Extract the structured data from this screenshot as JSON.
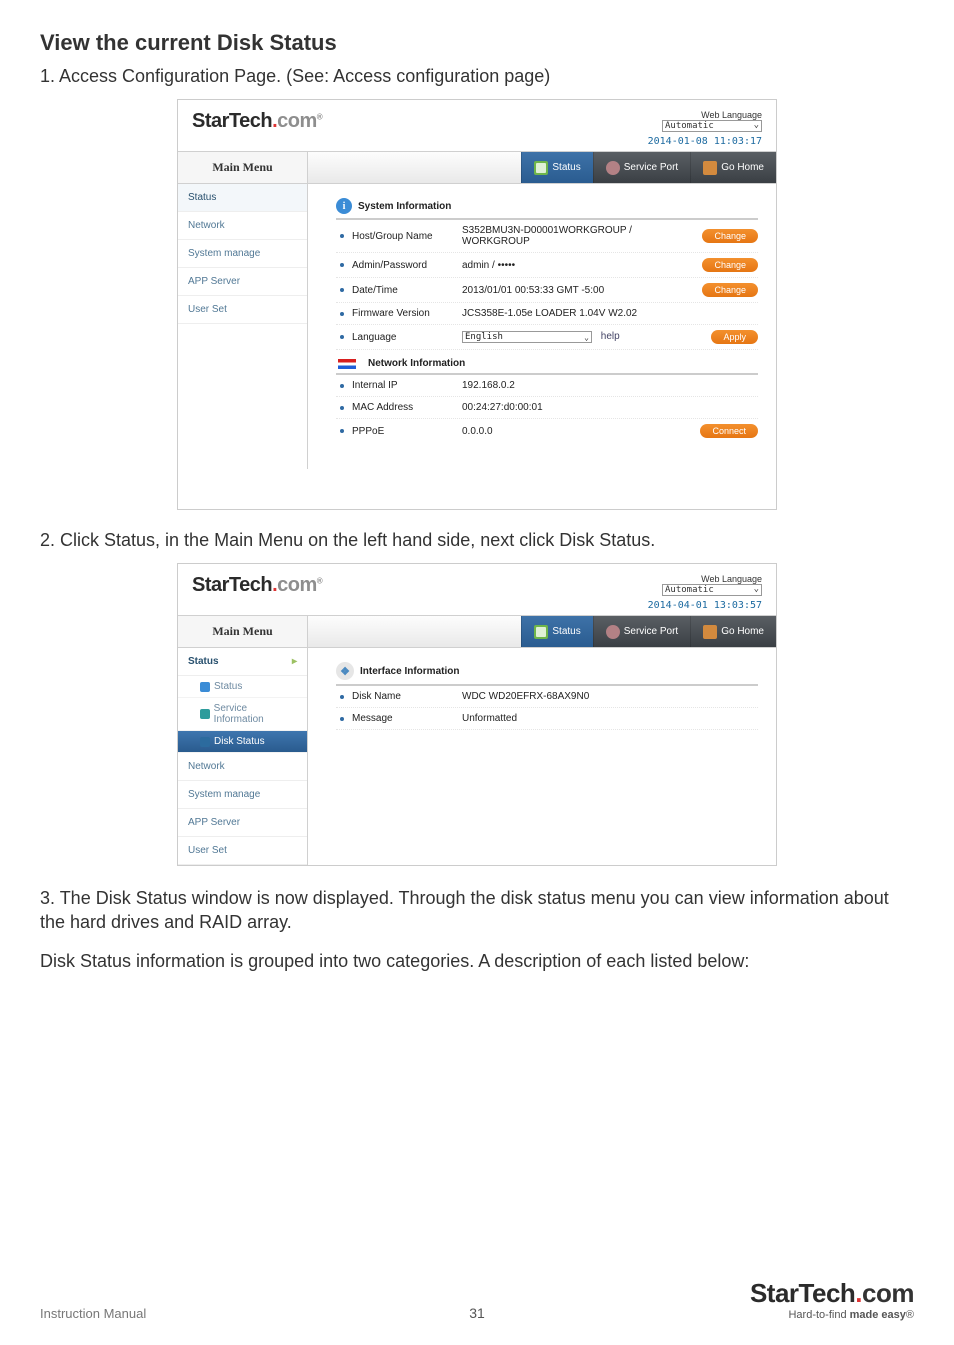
{
  "page": {
    "heading": "View the current Disk Status",
    "step1": "1.  Access Configuration Page. (See: Access configuration page)",
    "step2": "2.  Click Status, in the Main Menu on the left hand side, next click Disk Status.",
    "step3": "3.  The Disk Status window is now displayed. Through the disk status menu you can view information about the hard drives and RAID array.",
    "para": "Disk Status information is grouped into two categories. A description of each listed below:",
    "footer_im": "Instruction Manual",
    "footer_pg": "31",
    "brand_st": "StarTech",
    "brand_com": "com",
    "tagline_a": "Hard-to-find ",
    "tagline_b": "made easy"
  },
  "sc1": {
    "web_language_label": "Web Language",
    "web_language_value": "Automatic",
    "timestamp": "2014-01-08 11:03:17",
    "main_menu": "Main Menu",
    "tabs": {
      "status": "Status",
      "service_port": "Service Port",
      "go_home": "Go Home"
    },
    "sidebar": [
      "Status",
      "Network",
      "System manage",
      "APP Server",
      "User Set"
    ],
    "system_info_title": "System Information",
    "rows": {
      "host_label": "Host/Group Name",
      "host_value": "S352BMU3N-D00001WORKGROUP / WORKGROUP",
      "admin_label": "Admin/Password",
      "admin_value": "admin / •••••",
      "date_label": "Date/Time",
      "date_value": "2013/01/01 00:53:33 GMT -5:00",
      "fw_label": "Firmware Version",
      "fw_value": "JCS358E-1.05e LOADER 1.04V W2.02",
      "lang_label": "Language",
      "lang_value": "English",
      "lang_help": "help"
    },
    "network_info_title": "Network Information",
    "net": {
      "ip_label": "Internal IP",
      "ip_value": "192.168.0.2",
      "mac_label": "MAC Address",
      "mac_value": "00:24:27:d0:00:01",
      "pppoe_label": "PPPoE",
      "pppoe_value": "0.0.0.0"
    },
    "buttons": {
      "change": "Change",
      "apply": "Apply",
      "connect": "Connect"
    }
  },
  "sc2": {
    "web_language_label": "Web Language",
    "web_language_value": "Automatic",
    "timestamp": "2014-04-01 13:03:57",
    "main_menu": "Main Menu",
    "tabs": {
      "status": "Status",
      "service_port": "Service Port",
      "go_home": "Go Home"
    },
    "sidebar_top": "Status",
    "sidebar_subs": [
      {
        "label": "Status"
      },
      {
        "label": "Service Information"
      },
      {
        "label": "Disk Status"
      }
    ],
    "sidebar_rest": [
      "Network",
      "System manage",
      "APP Server",
      "User Set"
    ],
    "panel_title": "Interface Information",
    "rows": {
      "disk_label": "Disk Name",
      "disk_value": "WDC WD20EFRX-68AX9N0",
      "msg_label": "Message",
      "msg_value": "Unformatted"
    }
  }
}
